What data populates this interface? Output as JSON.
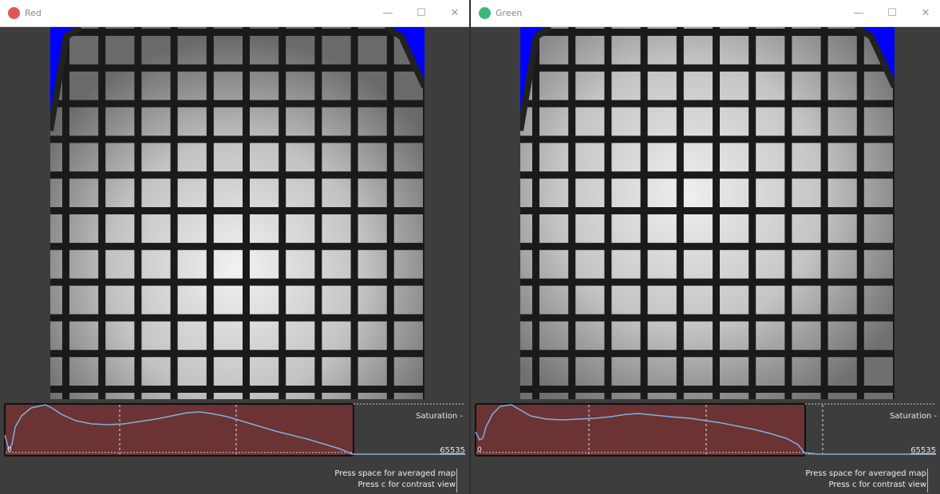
{
  "windows": [
    {
      "title": "Red",
      "dot_color": "#e05555",
      "controls": {
        "minimize": "—",
        "maximize": "☐",
        "close": "✕"
      },
      "histogram": {
        "min_label": "0",
        "max_label": "65535",
        "saturation_label": "Saturation -"
      },
      "hints": [
        "Press space for averaged map",
        "Press c for contrast view"
      ]
    },
    {
      "title": "Green",
      "dot_color": "#3cb878",
      "controls": {
        "minimize": "—",
        "maximize": "☐",
        "close": "✕"
      },
      "histogram": {
        "min_label": "0",
        "max_label": "65535",
        "saturation_label": "Saturation -"
      },
      "hints": [
        "Press space for averaged map",
        "Press c for contrast view"
      ]
    }
  ],
  "colors": {
    "saturation_fill": "#6b3333",
    "histogram_curve": "#7fb0e0",
    "image_background": "#0000ff",
    "grid_bar": "#1a1a1a"
  }
}
